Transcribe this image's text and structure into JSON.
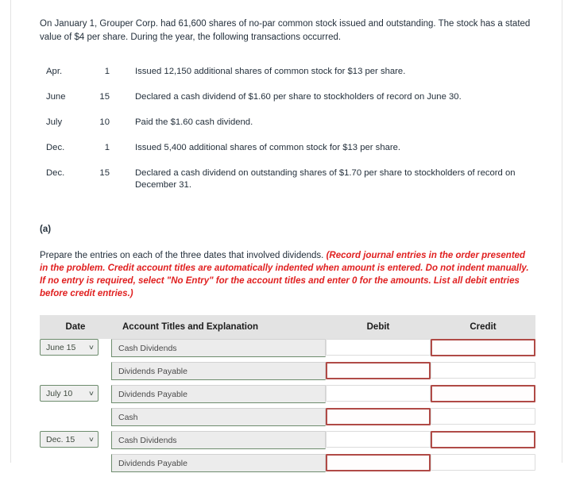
{
  "intro": "On January 1, Grouper Corp. had 61,600 shares of no-par common stock issued and outstanding. The stock has a stated value of $4 per share. During the year, the following transactions occurred.",
  "transactions": [
    {
      "month": "Apr.",
      "day": "1",
      "description": "Issued 12,150 additional shares of common stock for $13 per share."
    },
    {
      "month": "June",
      "day": "15",
      "description": "Declared a cash dividend of $1.60 per share to stockholders of record on June 30."
    },
    {
      "month": "July",
      "day": "10",
      "description": "Paid the $1.60 cash dividend."
    },
    {
      "month": "Dec.",
      "day": "1",
      "description": "Issued 5,400 additional shares of common stock for $13 per share."
    },
    {
      "month": "Dec.",
      "day": "15",
      "description": "Declared a cash dividend on outstanding shares of $1.70 per share to stockholders of record on December 31."
    }
  ],
  "part": {
    "label": "(a)",
    "prompt_main": "Prepare the entries on each of the three dates that involved dividends. ",
    "prompt_hint": "(Record journal entries in the order presented in the problem. Credit account titles are automatically indented when amount is entered. Do not indent manually. If no entry is required, select \"No Entry\" for the account titles and enter 0 for the amounts. List all debit entries before credit entries.)"
  },
  "journal": {
    "headers": {
      "date": "Date",
      "account": "Account Titles and Explanation",
      "debit": "Debit",
      "credit": "Credit"
    },
    "caret_glyph": "∨",
    "rows": [
      {
        "date": "June 15",
        "account": "Cash Dividends",
        "debit_flagged": false,
        "credit_flagged": true,
        "debit_value": "",
        "credit_value": "",
        "new_entry": true
      },
      {
        "date": "",
        "account": "Dividends Payable",
        "debit_flagged": true,
        "credit_flagged": false,
        "debit_value": "",
        "credit_value": "",
        "new_entry": false
      },
      {
        "date": "July 10",
        "account": "Dividends Payable",
        "debit_flagged": false,
        "credit_flagged": true,
        "debit_value": "",
        "credit_value": "",
        "new_entry": true
      },
      {
        "date": "",
        "account": "Cash",
        "debit_flagged": true,
        "credit_flagged": false,
        "debit_value": "",
        "credit_value": "",
        "new_entry": false
      },
      {
        "date": "Dec. 15",
        "account": "Cash Dividends",
        "debit_flagged": false,
        "credit_flagged": true,
        "debit_value": "",
        "credit_value": "",
        "new_entry": true
      },
      {
        "date": "",
        "account": "Dividends Payable",
        "debit_flagged": true,
        "credit_flagged": false,
        "debit_value": "",
        "credit_value": "",
        "new_entry": false
      }
    ]
  },
  "colors": {
    "hint_red": "#e02020",
    "flag_border": "#b04a46",
    "field_green": "#6d8c6d",
    "header_gray": "#e3e3e3"
  }
}
